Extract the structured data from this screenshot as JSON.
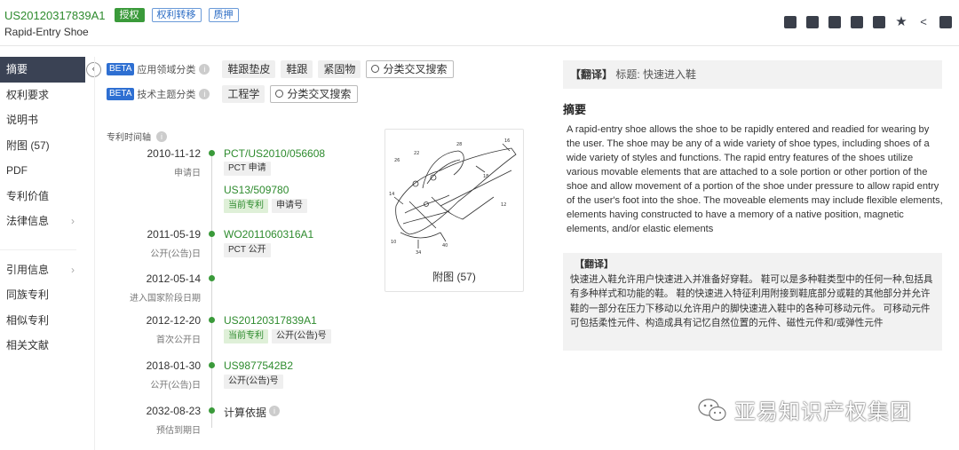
{
  "header": {
    "publication_number": "US20120317839A1",
    "tags": [
      "授权",
      "权利转移",
      "质押"
    ],
    "title": "Rapid-Entry Shoe",
    "toolbar_icons": [
      "export-icon",
      "folder-icon",
      "copy-icon",
      "monitor-icon",
      "mail-icon",
      "star-icon",
      "share-icon",
      "translate-icon"
    ]
  },
  "sidebar": {
    "items": [
      {
        "label": "摘要",
        "active": true
      },
      {
        "label": "权利要求"
      },
      {
        "label": "说明书"
      },
      {
        "label": "附图 (57)"
      },
      {
        "label": "PDF"
      },
      {
        "label": "专利价值"
      },
      {
        "label": "法律信息",
        "arrow": true
      }
    ],
    "items2": [
      {
        "label": "引用信息",
        "arrow": true
      },
      {
        "label": "同族专利"
      },
      {
        "label": "相似专利"
      },
      {
        "label": "相关文献"
      }
    ]
  },
  "classification": {
    "beta": "BETA",
    "row1": {
      "label": "应用领域分类",
      "chips": [
        "鞋跟垫皮",
        "鞋跟",
        "紧固物"
      ],
      "search": "分类交叉搜索"
    },
    "row2": {
      "label": "技术主题分类",
      "chips": [
        "工程学"
      ],
      "search": "分类交叉搜索"
    }
  },
  "timeline": {
    "heading": "专利时间轴",
    "events": [
      {
        "date": "2010-11-12",
        "sub": "申请日",
        "link": "PCT/US2010/056608",
        "chips": [
          "PCT 申请"
        ],
        "link2": "US13/509780",
        "chips2": [
          "当前专利",
          "申请号"
        ]
      },
      {
        "date": "2011-05-19",
        "sub": "公开(公告)日",
        "link": "WO2011060316A1",
        "chips": [
          "PCT 公开"
        ]
      },
      {
        "date": "2012-05-14",
        "sub": "进入国家阶段日期"
      },
      {
        "date": "2012-12-20",
        "sub": "首次公开日",
        "link": "US20120317839A1",
        "chips": [
          "当前专利",
          "公开(公告)号"
        ]
      },
      {
        "date": "2018-01-30",
        "sub": "公开(公告)日",
        "link": "US9877542B2",
        "chips": [
          "公开(公告)号"
        ]
      },
      {
        "date": "2032-08-23",
        "sub": "预估到期日",
        "text": "计算依据"
      }
    ]
  },
  "figure": {
    "caption": "附图 (57)"
  },
  "abstract": {
    "title_translation_label": "【翻译】",
    "title_translation": "标题: 快速进入鞋",
    "heading": "摘要",
    "body": "A rapid-entry shoe allows the shoe to be rapidly entered and readied for wearing by the user. The shoe may be any of a wide variety of shoe types, including shoes of a wide variety of styles and functions. The rapid entry features of the shoes utilize various movable elements that are attached to a sole portion or other portion of the shoe and allow movement of a portion of the shoe under pressure to allow rapid entry of the user's foot into the shoe. The moveable elements may include flexible elements, elements having constructed to have a memory of a native position, magnetic elements, and/or elastic elements",
    "translation_label": "【翻译】",
    "translation_body": "快速进入鞋允许用户快速进入并准备好穿鞋。 鞋可以是多种鞋类型中的任何一种,包括具有多种样式和功能的鞋。 鞋的快速进入特征利用附接到鞋底部分或鞋的其他部分并允许鞋的一部分在压力下移动以允许用户的脚快速进入鞋中的各种可移动元件。 可移动元件可包括柔性元件、构造成具有记忆自然位置的元件、磁性元件和/或弹性元件"
  },
  "watermark": {
    "text": "亚易知识产权集团"
  }
}
